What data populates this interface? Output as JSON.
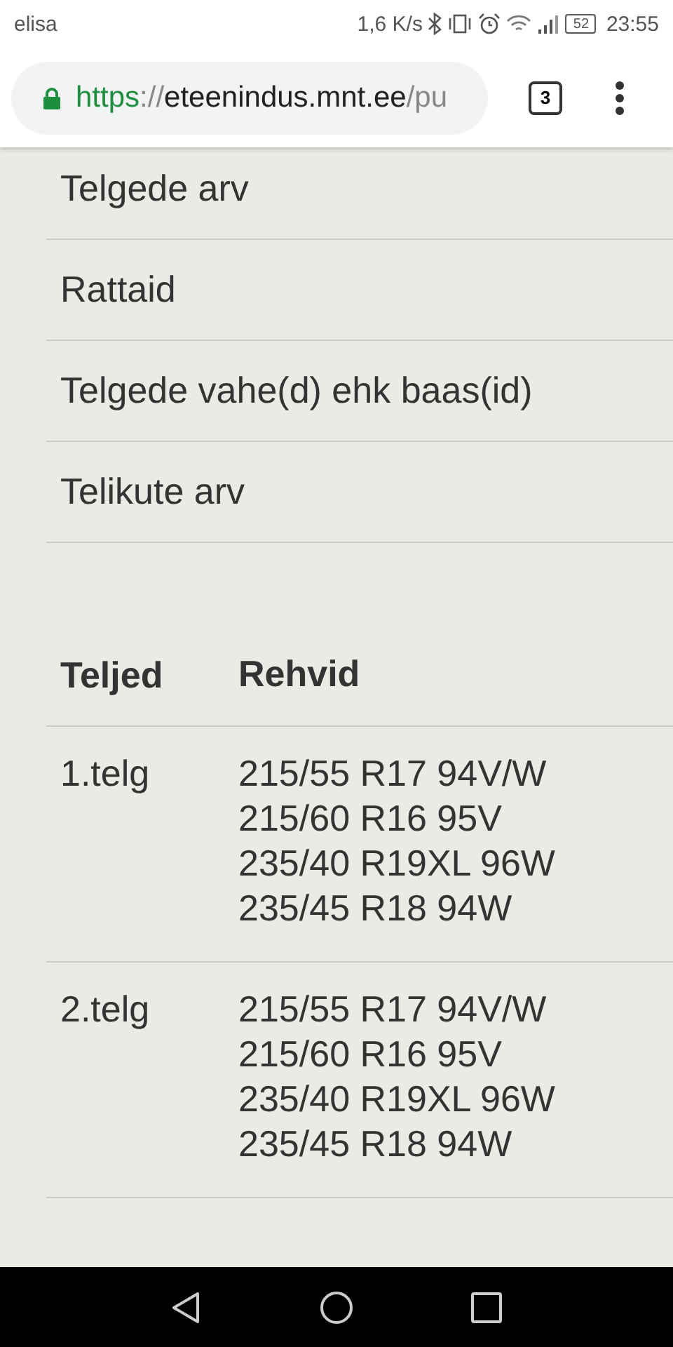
{
  "status_bar": {
    "carrier": "elisa",
    "speed": "1,6 K/s",
    "battery": "52",
    "time": "23:55"
  },
  "browser": {
    "url": {
      "scheme": "https",
      "separator": "://",
      "host": "eteenindus.mnt.ee",
      "path": "/pu"
    },
    "tab_count": "3"
  },
  "fields": [
    "Telgede arv",
    "Rattaid",
    "Telgede vahe(d) ehk baas(id)",
    "Telikute arv"
  ],
  "table": {
    "columns": [
      "Teljed",
      "Rehvid"
    ],
    "rows": [
      {
        "axle": "1.telg",
        "tires": [
          "215/55 R17 94V/W",
          "215/60 R16 95V",
          "235/40 R19XL 96W",
          "235/45 R18 94W"
        ]
      },
      {
        "axle": "2.telg",
        "tires": [
          "215/55 R17 94V/W",
          "215/60 R16 95V",
          "235/40 R19XL 96W",
          "235/45 R18 94W"
        ]
      }
    ]
  }
}
